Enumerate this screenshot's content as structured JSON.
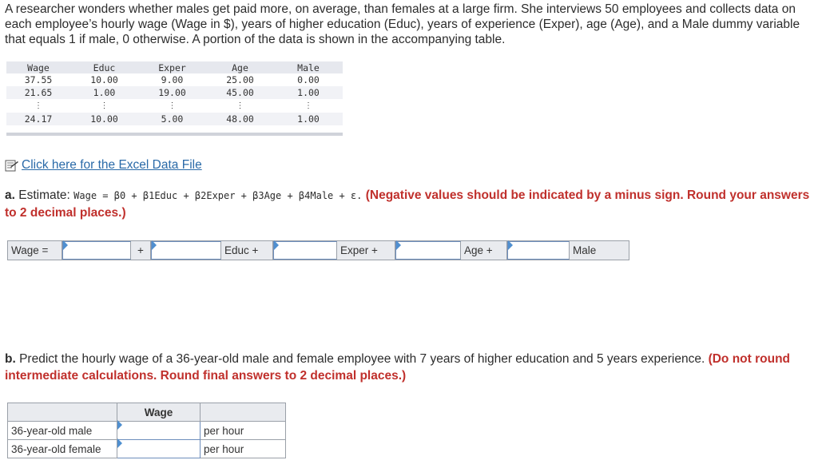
{
  "intro": "A researcher wonders whether males get paid more, on average, than females at a large firm. She interviews 50 employees and collects data on each employee’s hourly wage (Wage in $), years of higher education (Educ), years of experience (Exper), age (Age), and a Male dummy variable that equals 1 if male, 0 otherwise. A portion of the data is shown in the accompanying table.",
  "data_table": {
    "headers": [
      "Wage",
      "Educ",
      "Exper",
      "Age",
      "Male"
    ],
    "rows": [
      [
        "37.55",
        "10.00",
        "9.00",
        "25.00",
        "0.00"
      ],
      [
        "21.65",
        "1.00",
        "19.00",
        "45.00",
        "1.00"
      ],
      [
        "⋮",
        "⋮",
        "⋮",
        "⋮",
        "⋮"
      ],
      [
        "24.17",
        "10.00",
        "5.00",
        "48.00",
        "1.00"
      ]
    ]
  },
  "excel_link": "Click here for the Excel Data File",
  "part_a": {
    "prefix": "a.",
    "estimate": "Estimate:",
    "equation": "Wage = β0 + β1Educ + β2Exper + β3Age + β4Male + ε.",
    "instruction": "(Negative values should be indicated by a minus sign. Round your answers to 2 decimal places.)"
  },
  "equation_row": {
    "wage": "Wage =",
    "plus": "+",
    "educ": "Educ +",
    "exper": "Exper +",
    "age": "Age +",
    "male": "Male"
  },
  "part_b": {
    "prefix": "b.",
    "question": "Predict the hourly wage of a 36-year-old male and female employee with 7 years of higher education and 5 years experience.",
    "instruction": "(Do not round intermediate calculations. Round final answers to 2 decimal places.)"
  },
  "answer_table": {
    "header": "Wage",
    "rows": [
      {
        "label": "36-year-old male",
        "unit": "per hour"
      },
      {
        "label": "36-year-old female",
        "unit": "per hour"
      }
    ]
  },
  "colors": {
    "accent_red": "#c0302c",
    "link_blue": "#2a6aa8",
    "input_border": "#6d8ebc",
    "label_bg": "#e9ebef"
  }
}
